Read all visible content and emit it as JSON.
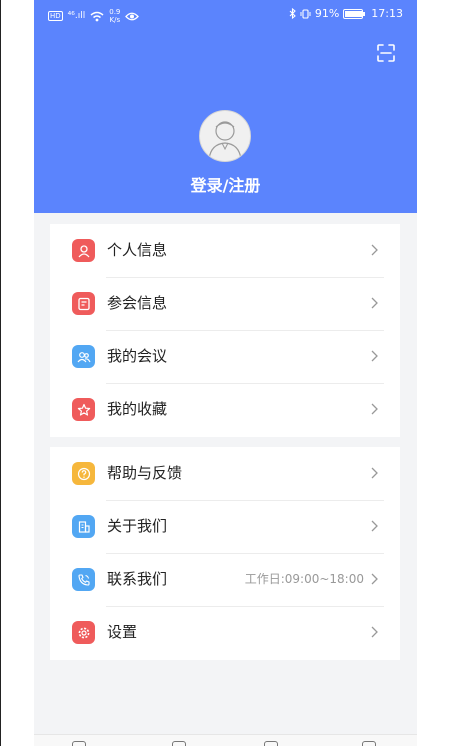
{
  "status_bar": {
    "net_badge": "HD",
    "signal": "⁴⁶.ıll",
    "speed_value": "0.9",
    "speed_unit": "K/s",
    "battery_text": "91%",
    "time": "17:13"
  },
  "header": {
    "login_label": "登录/注册",
    "scan_icon": "scan-icon"
  },
  "colors": {
    "header_blue": "#5b84fd",
    "red": "#ef5b5b",
    "blue": "#52a7f3",
    "orange": "#f6b73c"
  },
  "menu_group_1": [
    {
      "label": "个人信息",
      "icon": "person-icon"
    },
    {
      "label": "参会信息",
      "icon": "badge-icon"
    },
    {
      "label": "我的会议",
      "icon": "people-icon"
    },
    {
      "label": "我的收藏",
      "icon": "star-icon"
    }
  ],
  "menu_group_2": [
    {
      "label": "帮助与反馈",
      "icon": "help-icon"
    },
    {
      "label": "关于我们",
      "icon": "building-icon"
    },
    {
      "label": "联系我们",
      "icon": "phone-icon",
      "extra": "工作日:09:00~18:00"
    },
    {
      "label": "设置",
      "icon": "gear-icon"
    }
  ]
}
